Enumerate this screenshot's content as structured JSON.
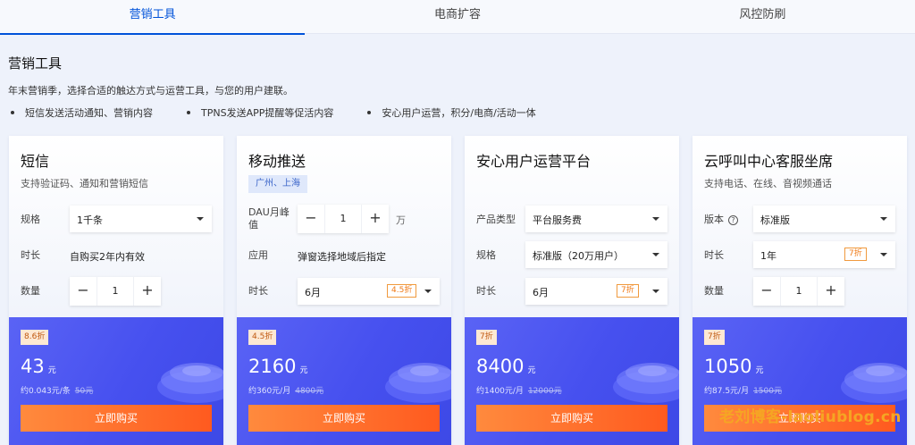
{
  "tabs": [
    "营销工具",
    "电商扩容",
    "风控防刷"
  ],
  "section": {
    "title": "营销工具",
    "intro": "年末营销季，选择合适的触达方式与运营工具，与您的用户建联。",
    "features": [
      "短信发送活动通知、营销内容",
      "TPNS发送APP提醒等促活内容",
      "安心用户运营，积分/电商/活动一体"
    ]
  },
  "cards": [
    {
      "name": "短信",
      "desc": "支持验证码、通知和营销短信",
      "spec_label": "规格",
      "spec_value": "1千条",
      "duration_label": "时长",
      "duration_value": "自购买2年内有效",
      "qty_label": "数量",
      "qty": "1",
      "discount": "8.6折",
      "price": "43",
      "price_unit": "元",
      "sub_price": "约0.043元/条",
      "orig_price": "50元",
      "buy": "立即购买"
    },
    {
      "name": "移动推送",
      "region": "广州、上海",
      "dau_label": "DAU月峰值",
      "dau": "1",
      "dau_unit": "万",
      "app_label": "应用",
      "app_value": "弹窗选择地域后指定",
      "duration_label": "时长",
      "duration_value": "6月",
      "duration_tag": "4.5折",
      "discount": "4.5折",
      "price": "2160",
      "price_unit": "元",
      "sub_price": "约360元/月",
      "orig_price": "4800元",
      "buy": "立即购买"
    },
    {
      "name": "安心用户运营平台",
      "product_label": "产品类型",
      "product_value": "平台服务费",
      "spec_label": "规格",
      "spec_value": "标准版（20万用户）",
      "duration_label": "时长",
      "duration_value": "6月",
      "duration_tag": "7折",
      "discount": "7折",
      "price": "8400",
      "price_unit": "元",
      "sub_price": "约1400元/月",
      "orig_price": "12000元",
      "buy": "立即购买"
    },
    {
      "name": "云呼叫中心客服坐席",
      "desc": "支持电话、在线、音视频通话",
      "version_label": "版本",
      "version_value": "标准版",
      "duration_label": "时长",
      "duration_value": "1年",
      "duration_tag": "7折",
      "qty_label": "数量",
      "qty": "1",
      "discount": "7折",
      "price": "1050",
      "price_unit": "元",
      "sub_price": "约87.5元/月",
      "orig_price": "1500元",
      "buy": "立即购买"
    }
  ],
  "watermark": "老刘博客-laoliublog.cn",
  "colors": {
    "accent": "#0052d9",
    "buy_gradient_start": "#ff8a3d",
    "buy_gradient_end": "#ff5a1f",
    "price_panel": "#4650ef"
  }
}
